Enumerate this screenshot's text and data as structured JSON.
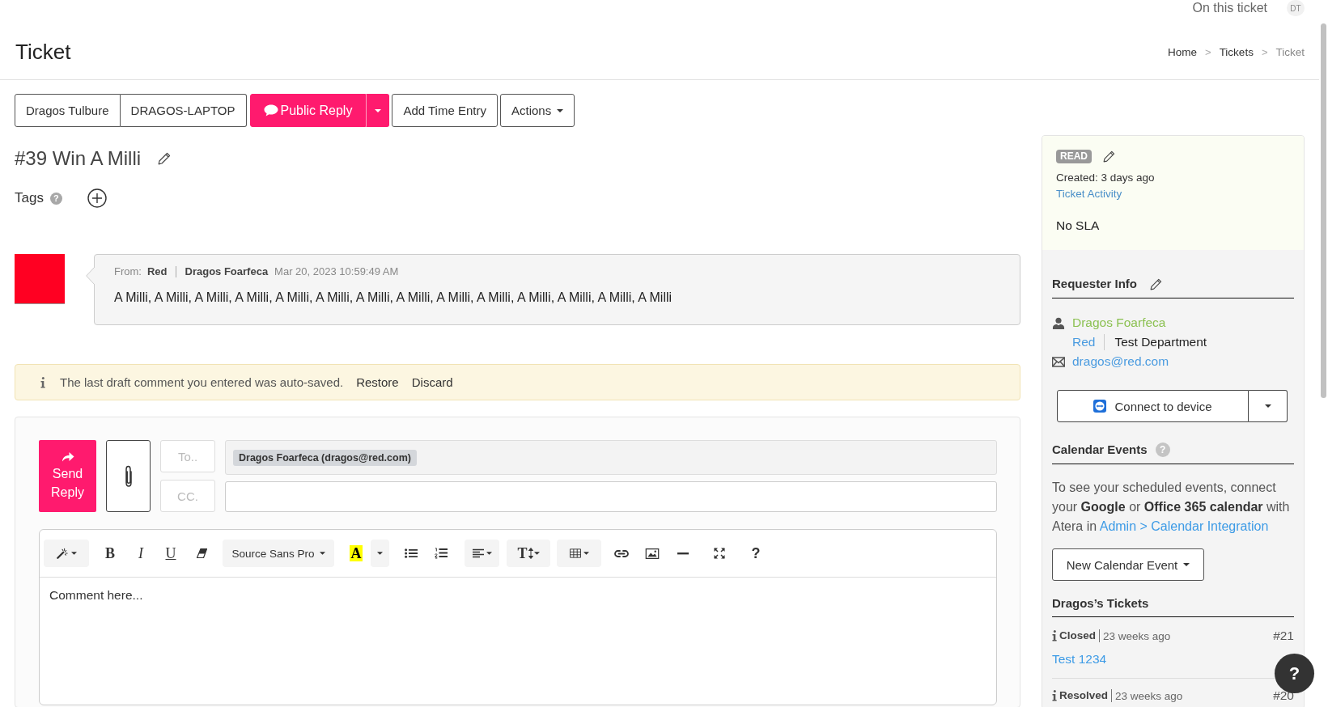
{
  "top_bar": {
    "presence_label": "On this ticket",
    "avatar_initials": "DT"
  },
  "header": {
    "title": "Ticket",
    "breadcrumb": [
      {
        "label": "Home",
        "separator": ">",
        "current": false
      },
      {
        "label": "Tickets",
        "separator": ">",
        "current": false
      },
      {
        "label": "Ticket",
        "current": true
      }
    ]
  },
  "actions": [
    {
      "kind": "group",
      "label": "Dragos Tulbure"
    },
    {
      "kind": "group",
      "label": "DRAGOS-LAPTOP"
    },
    {
      "kind": "split",
      "label": "Public Reply"
    },
    {
      "kind": "plain",
      "label": "Add Time Entry"
    },
    {
      "kind": "dropdown",
      "label": "Actions"
    }
  ],
  "ticket": {
    "title": "#39 Win A Milli",
    "tags_label": "Tags",
    "tags_help": "?"
  },
  "message": {
    "from_label": "From:",
    "sender": "Red",
    "author": "Dragos Foarfeca",
    "timestamp": "Mar 20, 2023 10:59:49 AM",
    "body": "A Milli, A Milli, A Milli, A Milli, A Milli, A Milli, A Milli, A Milli, A Milli, A Milli, A Milli, A Milli, A Milli, A Milli"
  },
  "draft_notice": {
    "text": "The last draft comment you entered was auto-saved.",
    "actions": [
      "Restore",
      "Discard"
    ]
  },
  "reply": {
    "send_label": "Send Reply",
    "to_label": "To..",
    "cc_label": "CC.",
    "to_recipients": [
      "Dragos Foarfeca (dragos@red.com)"
    ],
    "placeholder": "Comment here...",
    "tools": [
      {
        "kind": "style-menu"
      },
      {
        "kind": "bold",
        "glyph": "B"
      },
      {
        "kind": "italic",
        "glyph": "I"
      },
      {
        "kind": "underline",
        "glyph": "U"
      },
      {
        "kind": "eraser"
      },
      {
        "kind": "font-menu",
        "label": "Source Sans Pro"
      },
      {
        "kind": "highlight",
        "glyph": "A"
      },
      {
        "kind": "color-menu"
      },
      {
        "kind": "bullets"
      },
      {
        "kind": "numbers"
      },
      {
        "kind": "align-menu"
      },
      {
        "kind": "size-menu",
        "glyph": "T"
      },
      {
        "kind": "table-menu"
      },
      {
        "kind": "link"
      },
      {
        "kind": "image"
      },
      {
        "kind": "rule"
      },
      {
        "kind": "fullscreen"
      },
      {
        "kind": "help",
        "glyph": "?"
      }
    ]
  },
  "sidebar": {
    "status_badge": "READ",
    "created": "Created: 3 days ago",
    "activity_link": "Ticket Activity",
    "sla": "No SLA",
    "requester": {
      "heading": "Requester Info",
      "name": "Dragos Foarfeca",
      "company": "Red",
      "department": "Test Department",
      "email": "dragos@red.com",
      "connect_label": "Connect to device"
    },
    "calendar": {
      "heading": "Calendar Events",
      "help": "?",
      "text": "To see your scheduled events, connect your **Google** or **Office 365 calendar** with Atera in",
      "link": "Admin > Calendar Integration",
      "button": "New Calendar Event"
    },
    "tickets": {
      "heading": "Dragos’s Tickets",
      "items": [
        {
          "status": "Closed",
          "age": "23 weeks ago",
          "number": "#21",
          "title": "Test 1234"
        },
        {
          "status": "Resolved",
          "age": "23 weeks ago",
          "number": "#20"
        }
      ]
    }
  },
  "help_button": {
    "glyph": "?"
  }
}
